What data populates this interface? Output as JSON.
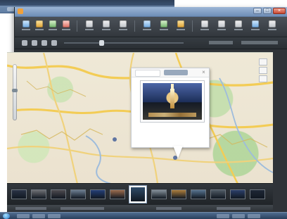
{
  "window": {
    "title": "",
    "controls": {
      "minimize": "–",
      "maximize": "□",
      "close": "×"
    }
  },
  "toolbar": {
    "labels": []
  },
  "map": {
    "roads_color": "#f3cc55",
    "road_alt_color": "#f0d27c",
    "river_color": "#9ebcdc"
  },
  "popup": {
    "tabs": [],
    "caption": "",
    "close_icon": "×"
  },
  "filmstrip": {
    "selected_index": 6,
    "items": [
      {
        "color": "#2a3345"
      },
      {
        "color": "#6e6f73"
      },
      {
        "color": "#4e4a4f"
      },
      {
        "color": "#6c7d91"
      },
      {
        "color": "#243f77"
      },
      {
        "color": "#9b6b4d"
      },
      {
        "color": "#2f4b68"
      },
      {
        "color": "#84909a"
      },
      {
        "color": "#ac7d3c"
      },
      {
        "color": "#57738f"
      },
      {
        "color": "#4f5a64"
      },
      {
        "color": "#2b3f6a"
      },
      {
        "color": "#1e2736"
      }
    ]
  }
}
